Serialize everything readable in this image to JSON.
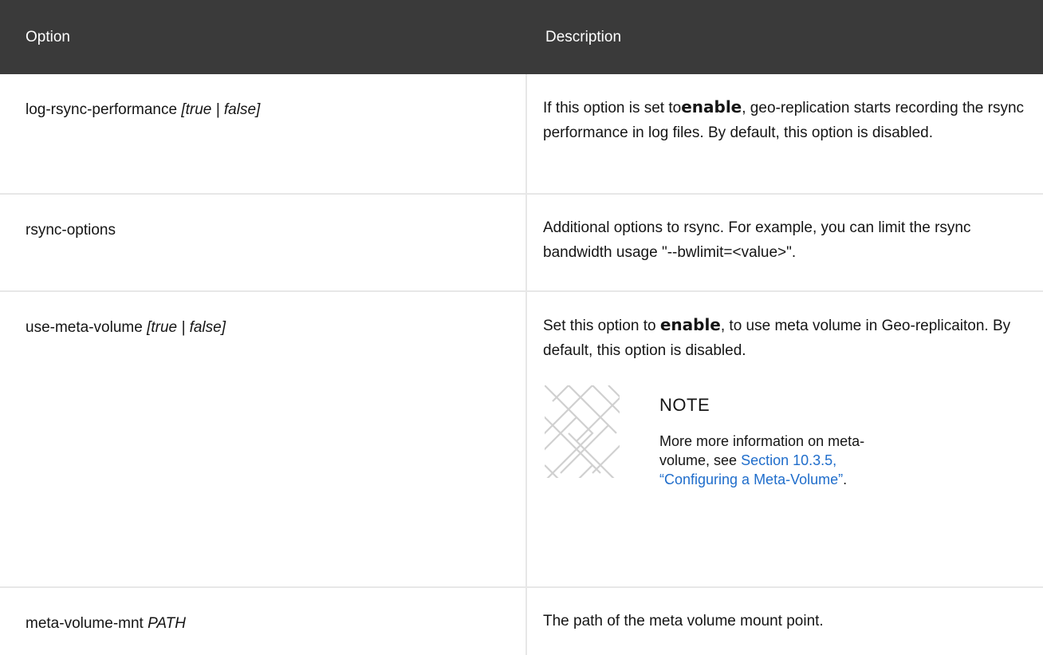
{
  "table": {
    "headers": {
      "option": "Option",
      "description": "Description"
    },
    "rows": [
      {
        "option_name": "log-rsync-performance",
        "option_args": "[true | false]",
        "desc_pre": "If this option is set to",
        "desc_keyword": "enable",
        "desc_post": ", geo-replication starts recording the rsync performance in log files. By default, this option is disabled."
      },
      {
        "option_name": "rsync-options",
        "description": "Additional options to rsync. For example, you can limit the rsync bandwidth usage \"--bwlimit=<value>\"."
      },
      {
        "option_name": "use-meta-volume",
        "option_args": "[true | false]",
        "desc_pre": "Set this option to",
        "desc_keyword": "enable",
        "desc_post": ", to use meta volume in Geo-replicaiton. By default, this option is disabled.",
        "note": {
          "icon": "note-pattern-icon",
          "title": "NOTE",
          "text_pre": "More more information on meta-volume, see",
          "link_text": "Section 10.3.5, “Configuring a Meta-Volume”",
          "text_post": "."
        }
      },
      {
        "option_name": "meta-volume-mnt",
        "option_args": "PATH",
        "description": "The path of the meta volume mount point."
      }
    ]
  }
}
